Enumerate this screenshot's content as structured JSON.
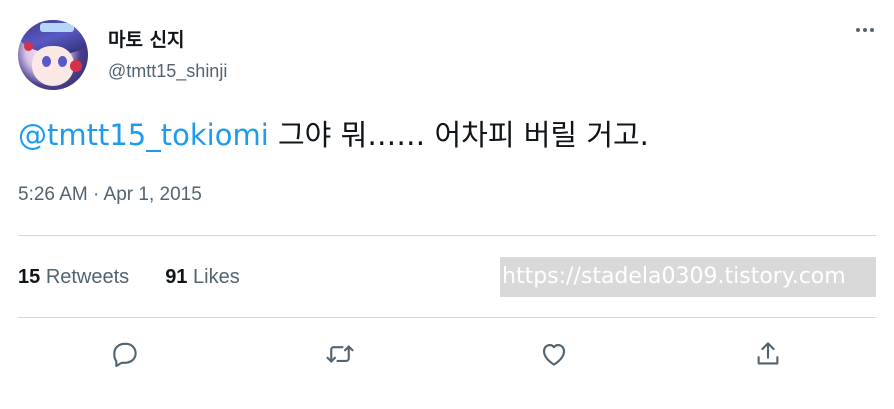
{
  "author": {
    "display_name": "마토 신지",
    "handle": "@tmtt15_shinji"
  },
  "tweet": {
    "mention": "@tmtt15_tokiomi",
    "text": " 그야 뭐…… 어차피 버릴 거고.",
    "timestamp": "5:26 AM · Apr 1, 2015"
  },
  "stats": {
    "retweets_count": "15",
    "retweets_label": "Retweets",
    "likes_count": "91",
    "likes_label": "Likes"
  },
  "watermark": "https://stadela0309.tistory.com",
  "icons": {
    "more": "more-horizontal-icon",
    "reply": "reply-icon",
    "retweet": "retweet-icon",
    "like": "heart-icon",
    "share": "share-icon"
  },
  "colors": {
    "link": "#1d9bf0",
    "secondary_text": "#536471",
    "primary_text": "#0f1419",
    "divider": "#cfd9de"
  }
}
